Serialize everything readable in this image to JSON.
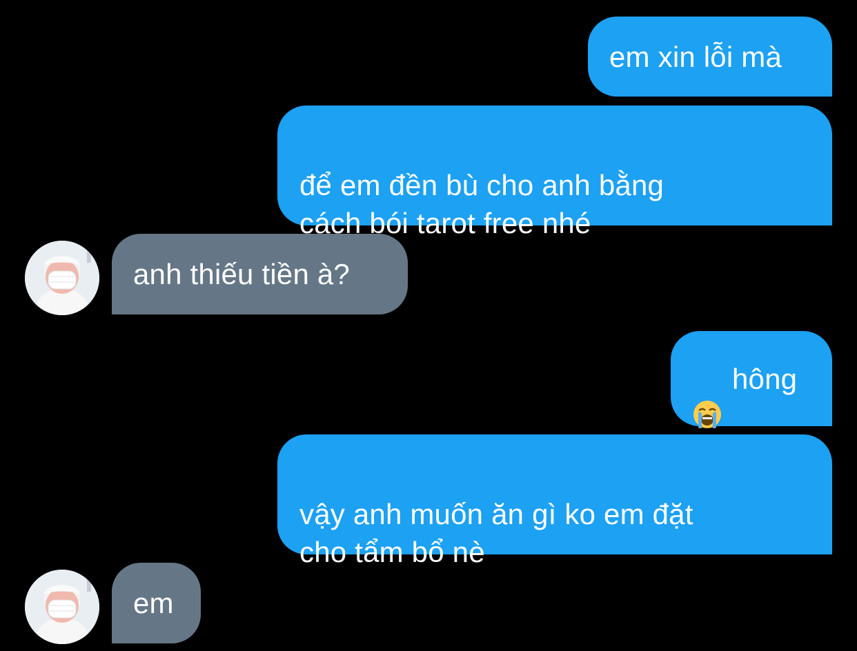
{
  "conversation": {
    "messages": [
      {
        "from": "me",
        "text": "em xin lỗi mà"
      },
      {
        "from": "me",
        "text": "để em đền bù cho anh bằng\ncách bói tarot free nhé"
      },
      {
        "from": "other",
        "text": "anh thiếu tiền à?"
      },
      {
        "from": "me",
        "emoji": "loudly-crying-face-icon",
        "text": "hông"
      },
      {
        "from": "me",
        "text": "vậy anh muốn ăn gì ko em đặt\ncho tẩm bổ nè"
      },
      {
        "from": "other",
        "text": "em"
      }
    ]
  },
  "colors": {
    "background": "#000000",
    "sent_bubble": "#1da1f2",
    "received_bubble": "#657786",
    "text": "#ffffff"
  }
}
